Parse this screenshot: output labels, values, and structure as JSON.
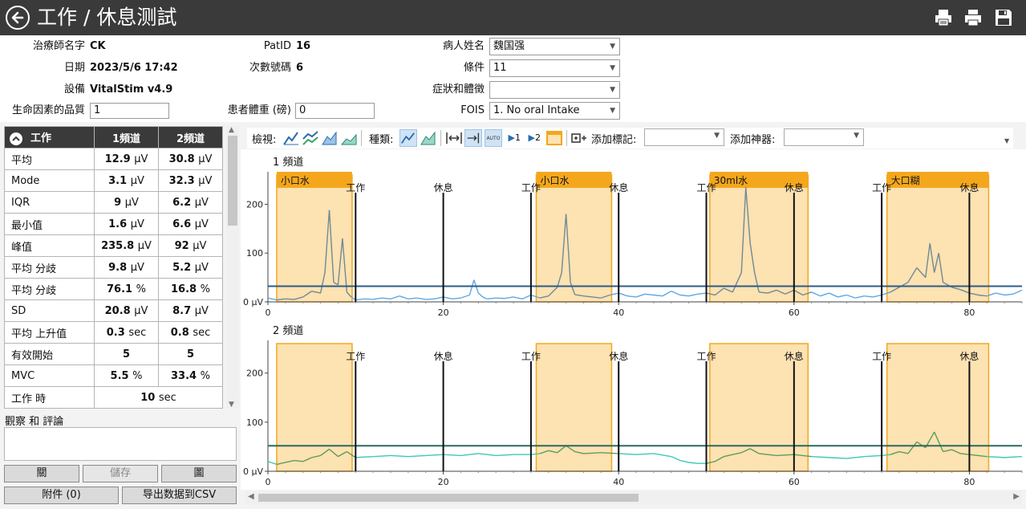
{
  "window": {
    "title": "工作 / 休息测試"
  },
  "header_info": {
    "therapist_label": "治療師名字",
    "therapist": "CK",
    "date_label": "日期",
    "date": "2023/5/6 17:42",
    "device_label": "設備",
    "device": "VitalStim v4.9",
    "qol_label": "生命因素的品質",
    "qol": "1",
    "patid_label": "PatID",
    "patid": "16",
    "session_label": "次數號碼",
    "session": "6",
    "weight_label": "患者體重 (磅)",
    "weight": "0",
    "patient_label": "病人姓名",
    "patient": "魏国强",
    "condition_label": "條件",
    "condition": "11",
    "symptoms_label": "症狀和體徵",
    "symptoms": "",
    "fois_label": "FOIS",
    "fois": "1. No oral Intake"
  },
  "stats": {
    "headers": [
      "工作",
      "1頻道",
      "2頻道"
    ],
    "rows": [
      {
        "label": "平均",
        "c1": "12.9",
        "u1": "µV",
        "c2": "30.8",
        "u2": "µV"
      },
      {
        "label": "Mode",
        "c1": "3.1",
        "u1": "µV",
        "c2": "32.3",
        "u2": "µV"
      },
      {
        "label": "IQR",
        "c1": "9",
        "u1": "µV",
        "c2": "6.2",
        "u2": "µV"
      },
      {
        "label": "最小值",
        "c1": "1.6",
        "u1": "µV",
        "c2": "6.6",
        "u2": "µV"
      },
      {
        "label": "峰值",
        "c1": "235.8",
        "u1": "µV",
        "c2": "92",
        "u2": "µV"
      },
      {
        "label": "平均 分歧",
        "c1": "9.8",
        "u1": "µV",
        "c2": "5.2",
        "u2": "µV"
      },
      {
        "label": "平均 分歧",
        "c1": "76.1",
        "u1": "%",
        "c2": "16.8",
        "u2": "%"
      },
      {
        "label": "SD",
        "c1": "20.8",
        "u1": "µV",
        "c2": "8.7",
        "u2": "µV"
      },
      {
        "label": "平均 上升值",
        "c1": "0.3",
        "u1": "sec",
        "c2": "0.8",
        "u2": "sec"
      },
      {
        "label": "有效開始",
        "c1": "5",
        "u1": "",
        "c2": "5",
        "u2": ""
      },
      {
        "label": "MVC",
        "c1": "5.5",
        "u1": "%",
        "c2": "33.4",
        "u2": "%"
      }
    ],
    "work_time_label": "工作 時",
    "work_time": "10",
    "work_time_unit": "sec"
  },
  "observations": {
    "label": "觀察 和 評論",
    "text": ""
  },
  "buttons": {
    "close": "關",
    "save": "儲存",
    "chart": "圖",
    "attachments": "附件 (0)",
    "export_csv": "导出数据到CSV"
  },
  "toolbar": {
    "view_label": "檢視:",
    "type_label": "種類:",
    "add_marker_label": "添加標記:",
    "add_device_label": "添加神器:",
    "auto_text": "AUTO",
    "ch1_text": "1",
    "ch2_text": "2"
  },
  "colors": {
    "titlebar": "#3a3a3a",
    "period_fill": "#fde2b2",
    "period_border": "#f4a71d",
    "ch1_active": "#6f8a94",
    "ch1_rest": "#5ba8e8",
    "ch1_threshold": "#2b5c8a",
    "ch2_active": "#5e9c5a",
    "ch2_rest": "#3cc9b5",
    "ch2_threshold": "#2a6b60"
  },
  "chart_data": [
    {
      "type": "line",
      "title": "1 頻道",
      "xlim": [
        0,
        86
      ],
      "ylim": [
        0,
        260
      ],
      "x_ticks": [
        0,
        20,
        40,
        60,
        80
      ],
      "y_ticks": [
        0,
        100,
        200
      ],
      "y_tick_labels": [
        "0 µV",
        "100",
        "200"
      ],
      "threshold": 32,
      "periods": [
        {
          "start": 1,
          "end": 9.6,
          "label": "小口水"
        },
        {
          "start": 30.6,
          "end": 39.2,
          "label": "小口水"
        },
        {
          "start": 50.4,
          "end": 61.6,
          "label": "30ml水"
        },
        {
          "start": 70.6,
          "end": 82.2,
          "label": "大口糊"
        }
      ],
      "markers": [
        {
          "x": 10,
          "label": "工作"
        },
        {
          "x": 20,
          "label": "休息"
        },
        {
          "x": 30,
          "label": "工作"
        },
        {
          "x": 40,
          "label": "休息"
        },
        {
          "x": 50,
          "label": "工作"
        },
        {
          "x": 60,
          "label": "休息"
        },
        {
          "x": 70,
          "label": "工作"
        },
        {
          "x": 80,
          "label": "休息"
        }
      ],
      "x": [
        0,
        1,
        2,
        3,
        4,
        5,
        6,
        6.5,
        7,
        7.5,
        8,
        8.5,
        9,
        9.5,
        10,
        11,
        12,
        13,
        14,
        15,
        16,
        17,
        18,
        19,
        20,
        21,
        22,
        23,
        23.5,
        24,
        24.5,
        25,
        26,
        27,
        28,
        29,
        30,
        31,
        32,
        33,
        33.5,
        34,
        34.5,
        35,
        36,
        37,
        38,
        39,
        40,
        41,
        42,
        43,
        44,
        45,
        46,
        47,
        48,
        49,
        50,
        51,
        52,
        53,
        54,
        54.5,
        55,
        55.5,
        56,
        57,
        58,
        59,
        60,
        61,
        62,
        63,
        64,
        65,
        66,
        67,
        68,
        69,
        70,
        71,
        72,
        73,
        74,
        75,
        75.5,
        76,
        76.5,
        77,
        78,
        79,
        80,
        81,
        82,
        83,
        84,
        85,
        86
      ],
      "y": [
        8,
        4,
        6,
        5,
        10,
        22,
        18,
        60,
        188,
        40,
        35,
        130,
        20,
        10,
        4,
        6,
        5,
        8,
        6,
        12,
        6,
        8,
        5,
        6,
        10,
        6,
        8,
        14,
        45,
        18,
        10,
        6,
        8,
        7,
        10,
        6,
        14,
        8,
        12,
        30,
        60,
        180,
        40,
        15,
        12,
        10,
        8,
        14,
        18,
        12,
        10,
        16,
        14,
        12,
        22,
        14,
        12,
        16,
        18,
        14,
        28,
        20,
        60,
        235,
        120,
        60,
        20,
        18,
        24,
        16,
        24,
        14,
        20,
        12,
        18,
        10,
        14,
        8,
        12,
        10,
        14,
        20,
        30,
        40,
        70,
        50,
        120,
        60,
        100,
        40,
        30,
        25,
        18,
        14,
        12,
        18,
        14,
        16,
        24
      ]
    },
    {
      "type": "line",
      "title": "2 頻道",
      "xlim": [
        0,
        86
      ],
      "ylim": [
        0,
        260
      ],
      "x_ticks": [
        0,
        20,
        40,
        60,
        80
      ],
      "y_ticks": [
        0,
        100,
        200
      ],
      "y_tick_labels": [
        "0 µV",
        "100",
        "200"
      ],
      "threshold": 52,
      "periods": [
        {
          "start": 1,
          "end": 9.6,
          "label": ""
        },
        {
          "start": 30.6,
          "end": 39.2,
          "label": ""
        },
        {
          "start": 50.4,
          "end": 61.6,
          "label": ""
        },
        {
          "start": 70.6,
          "end": 82.2,
          "label": ""
        }
      ],
      "markers": [
        {
          "x": 10,
          "label": "工作"
        },
        {
          "x": 20,
          "label": "休息"
        },
        {
          "x": 30,
          "label": "工作"
        },
        {
          "x": 40,
          "label": "休息"
        },
        {
          "x": 50,
          "label": "工作"
        },
        {
          "x": 60,
          "label": "休息"
        },
        {
          "x": 70,
          "label": "工作"
        },
        {
          "x": 80,
          "label": "休息"
        }
      ],
      "x": [
        0,
        1,
        2,
        3,
        4,
        5,
        6,
        7,
        8,
        9,
        10,
        12,
        14,
        16,
        18,
        20,
        22,
        24,
        26,
        28,
        30,
        31,
        32,
        33,
        34,
        35,
        36,
        38,
        40,
        42,
        44,
        46,
        47,
        48,
        49,
        50,
        51,
        52,
        53,
        54,
        55,
        56,
        58,
        60,
        62,
        64,
        66,
        68,
        70,
        71,
        72,
        73,
        74,
        75,
        76,
        77,
        78,
        79,
        80,
        82,
        84,
        86
      ],
      "y": [
        20,
        14,
        18,
        22,
        20,
        28,
        32,
        45,
        30,
        40,
        28,
        30,
        32,
        30,
        32,
        34,
        32,
        36,
        32,
        34,
        34,
        36,
        42,
        38,
        52,
        40,
        36,
        38,
        36,
        34,
        36,
        30,
        22,
        18,
        16,
        16,
        20,
        30,
        34,
        38,
        46,
        36,
        32,
        34,
        30,
        28,
        26,
        30,
        32,
        34,
        40,
        36,
        60,
        48,
        80,
        40,
        44,
        36,
        34,
        30,
        28,
        30
      ]
    }
  ]
}
